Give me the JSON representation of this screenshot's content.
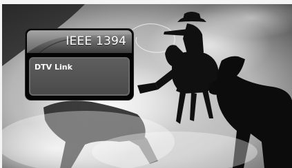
{
  "panel": {
    "title": "IEEE 1394",
    "items": [
      {
        "label": "DTV Link",
        "selected": true
      }
    ]
  },
  "colors": {
    "panel_bg": "#050505",
    "header_top": "#9a9a9a",
    "header_bottom": "#3d3d3d",
    "list_bg": "#555555",
    "text": "#ffffff"
  },
  "background": {
    "icon": "cowboy-rodeo-photo"
  }
}
